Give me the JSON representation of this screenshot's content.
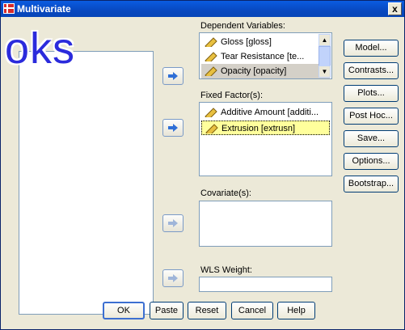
{
  "window": {
    "title": "Multivariate",
    "close_label": "x"
  },
  "watermark": "oks",
  "dependent": {
    "label": "Dependent Variables:",
    "items": [
      "Gloss [gloss]",
      "Tear Resistance [te...",
      "Opacity [opacity]"
    ]
  },
  "fixed": {
    "label": "Fixed Factor(s):",
    "items": [
      "Additive Amount [additi...",
      "Extrusion [extrusn]"
    ]
  },
  "covariates": {
    "label": "Covariate(s):"
  },
  "wls": {
    "label": "WLS Weight:"
  },
  "side_buttons": [
    "Model...",
    "Contrasts...",
    "Plots...",
    "Post Hoc...",
    "Save...",
    "Options...",
    "Bootstrap..."
  ],
  "bottom_buttons": [
    "OK",
    "Paste",
    "Reset",
    "Cancel",
    "Help"
  ],
  "colors": {
    "title_bar": "#0a5ce0",
    "arrow_active": "#2f6fd6",
    "arrow_disabled": "#9fb5d9",
    "selected_item": "#ffff9c"
  }
}
